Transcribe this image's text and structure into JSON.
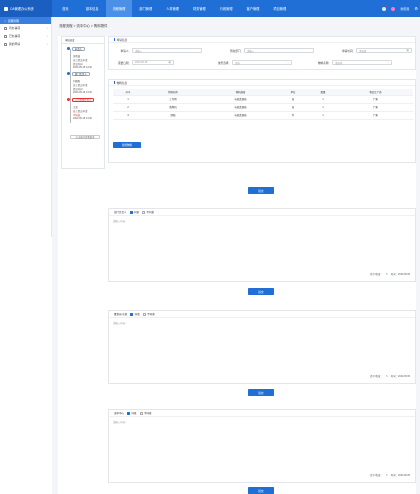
{
  "app": {
    "title": "OA管理办公系统"
  },
  "nav": {
    "items": [
      "首页",
      "基本信息",
      "流程管理",
      "部门管理",
      "人事管理",
      "财务管理",
      "行政管理",
      "客户管理",
      "项目管理"
    ],
    "active": 2
  },
  "user": {
    "name": "张晓曼"
  },
  "sidebar": {
    "header": "流程管理",
    "items": [
      "待办事项",
      "已办事项",
      "我的申请"
    ]
  },
  "breadcrumb": "流程流程 > 流中中心 > 购料物件",
  "tree": {
    "title": "审批进度",
    "nodes": [
      {
        "label": "申请人",
        "color": "#1f6fd6",
        "subs": [
          "张晓曼",
          "员工提交申请",
          "提交时间",
          "2020-05-15 14:30"
        ]
      },
      {
        "label": "部门负责人",
        "color": "#1f6fd6",
        "subs": [
          "刘朝阳",
          "员工提交申请",
          "提交时间",
          "2020-05-15 14:30"
        ]
      },
      {
        "label": "人力资源负责人",
        "color": "#e33333",
        "subs": [
          "王凯",
          "员工提交申请",
          "不同意",
          "2020-05-15 14:30"
        ]
      }
    ],
    "button": "点击展开查看更多"
  },
  "form": {
    "title": "申请信息",
    "applicant_label": "申请人：",
    "applicant_ph": "请输入",
    "dept_label": "所在部门：",
    "dept_ph": "请输入",
    "time_label": "申请时间：",
    "time_ph": "请选择",
    "date_label": "需要日期：",
    "date_val": "2020-05-15",
    "type_label": "类型选择：",
    "type_ph": "请选",
    "goods_label": "物料名称：",
    "goods_ph": "请选择"
  },
  "materials": {
    "title": "物料信息",
    "columns": [
      "序号",
      "物料名称",
      "物料规格",
      "单位",
      "数量",
      "物品生厂商"
    ],
    "rows": [
      [
        "1",
        "工作牌",
        "标准类规格",
        "张",
        "1",
        "厂家"
      ],
      [
        "2",
        "路牌机",
        "标准类规格",
        "张",
        "1",
        "厂家"
      ],
      [
        "3",
        "制服",
        "标准类规格",
        "件",
        "1",
        "厂家"
      ]
    ],
    "add_button": "新增物料"
  },
  "submit_label": "提交",
  "opinions": [
    {
      "title": "部门负责人",
      "agree": "同意",
      "disagree": "不同意",
      "placeholder": "请输入内容...",
      "sign_label": "签字/签章：",
      "date": "时间：2020.05.05"
    },
    {
      "title": "董事长/总裁",
      "agree": "同意",
      "disagree": "不同意",
      "placeholder": "请输入内容...",
      "sign_label": "签字/签章：",
      "date": "时间：2020.05.05"
    },
    {
      "title": "流中中心",
      "agree": "同意",
      "disagree": "不同意",
      "placeholder": "请输入内容...",
      "sign_label": "签字/签章：",
      "date": "时间：2020.05.05"
    }
  ],
  "colors": {
    "primary": "#1f6fd6",
    "sidebar_active": "#3a7fe0",
    "reject": "#e33333"
  }
}
